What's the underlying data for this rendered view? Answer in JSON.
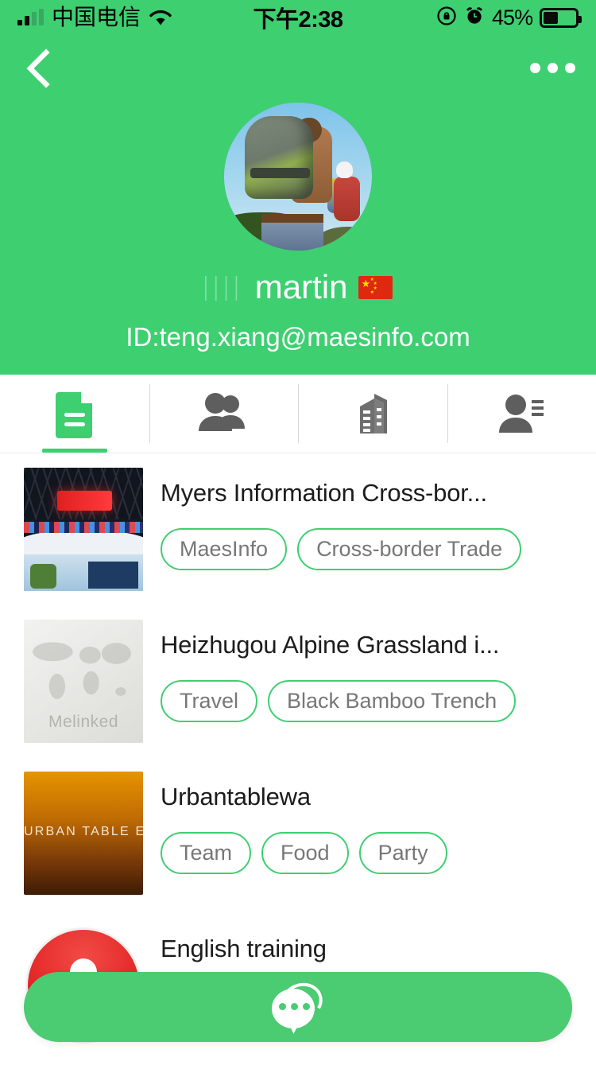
{
  "status_bar": {
    "carrier": "中国电信",
    "time": "下午2:38",
    "battery_percent": "45%",
    "icons": [
      "signal-icon",
      "wifi-icon",
      "rotation-lock-icon",
      "alarm-clock-icon",
      "battery-icon"
    ]
  },
  "navbar": {
    "back_icon": "chevron-left-icon",
    "more_icon": "more-options-icon"
  },
  "profile": {
    "avatar_alt": "hikers-with-backpacks",
    "name_prefix": "||||",
    "name": "martin",
    "flag": "china-flag",
    "id_label": "ID:teng.xiang@maesinfo.com"
  },
  "tabs": [
    {
      "name": "tab-posts",
      "icon": "document-icon",
      "active": true
    },
    {
      "name": "tab-groups",
      "icon": "people-icon",
      "active": false
    },
    {
      "name": "tab-company",
      "icon": "building-icon",
      "active": false
    },
    {
      "name": "tab-contacts",
      "icon": "person-list-icon",
      "active": false
    }
  ],
  "list": [
    {
      "title": "Myers Information Cross-bor...",
      "thumb": "exhibition-booth-photo",
      "tags": [
        "MaesInfo",
        "Cross-border Trade"
      ]
    },
    {
      "title": "Heizhugou Alpine Grassland i...",
      "thumb": "melinked-world-map-placeholder",
      "thumb_watermark": "Melinked",
      "tags": [
        "Travel",
        "Black Bamboo Trench"
      ]
    },
    {
      "title": "Urbantablewa",
      "thumb": "urban-table-event-poster",
      "thumb_caption": "URBAN TABLE EVEN",
      "tags": [
        "Team",
        "Food",
        "Party"
      ]
    },
    {
      "title": "English training",
      "thumb": "red-microphone-logo",
      "tags": []
    }
  ],
  "chat_button": {
    "icon": "chat-bubble-icon"
  },
  "colors": {
    "brand_green": "#3ECF71",
    "fab_green": "#4BCB72",
    "tag_border": "#3ECF71",
    "tag_text": "#777777",
    "title_text": "#1C1C1C"
  }
}
